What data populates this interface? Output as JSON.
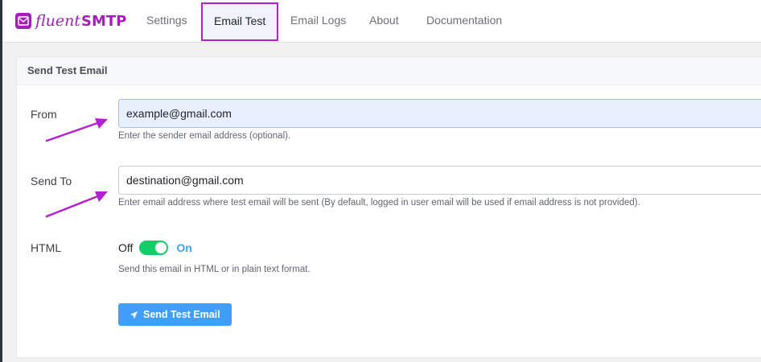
{
  "brand": {
    "word_a": "fluent",
    "word_b": "SMTP",
    "color": "#a31fb8"
  },
  "nav": {
    "items": [
      {
        "label": "Settings"
      },
      {
        "label": "Email Test"
      },
      {
        "label": "Email Logs"
      },
      {
        "label": "About"
      },
      {
        "label": "Documentation"
      }
    ],
    "active_index": 1
  },
  "panel": {
    "title": "Send Test Email",
    "from": {
      "label": "From",
      "value": "example@gmail.com",
      "help": "Enter the sender email address (optional)."
    },
    "send_to": {
      "label": "Send To",
      "value": "destination@gmail.com",
      "help": "Enter email address where test email will be sent (By default, logged in user email will be used if email address is not provided)."
    },
    "html": {
      "label": "HTML",
      "off_label": "Off",
      "on_label": "On",
      "enabled": true,
      "help": "Send this email in HTML or in plain text format."
    },
    "send_button_label": "Send Test Email"
  },
  "colors": {
    "accent": "#409eff",
    "toggle_on": "#13ce66",
    "highlight": "#b41fd0"
  }
}
